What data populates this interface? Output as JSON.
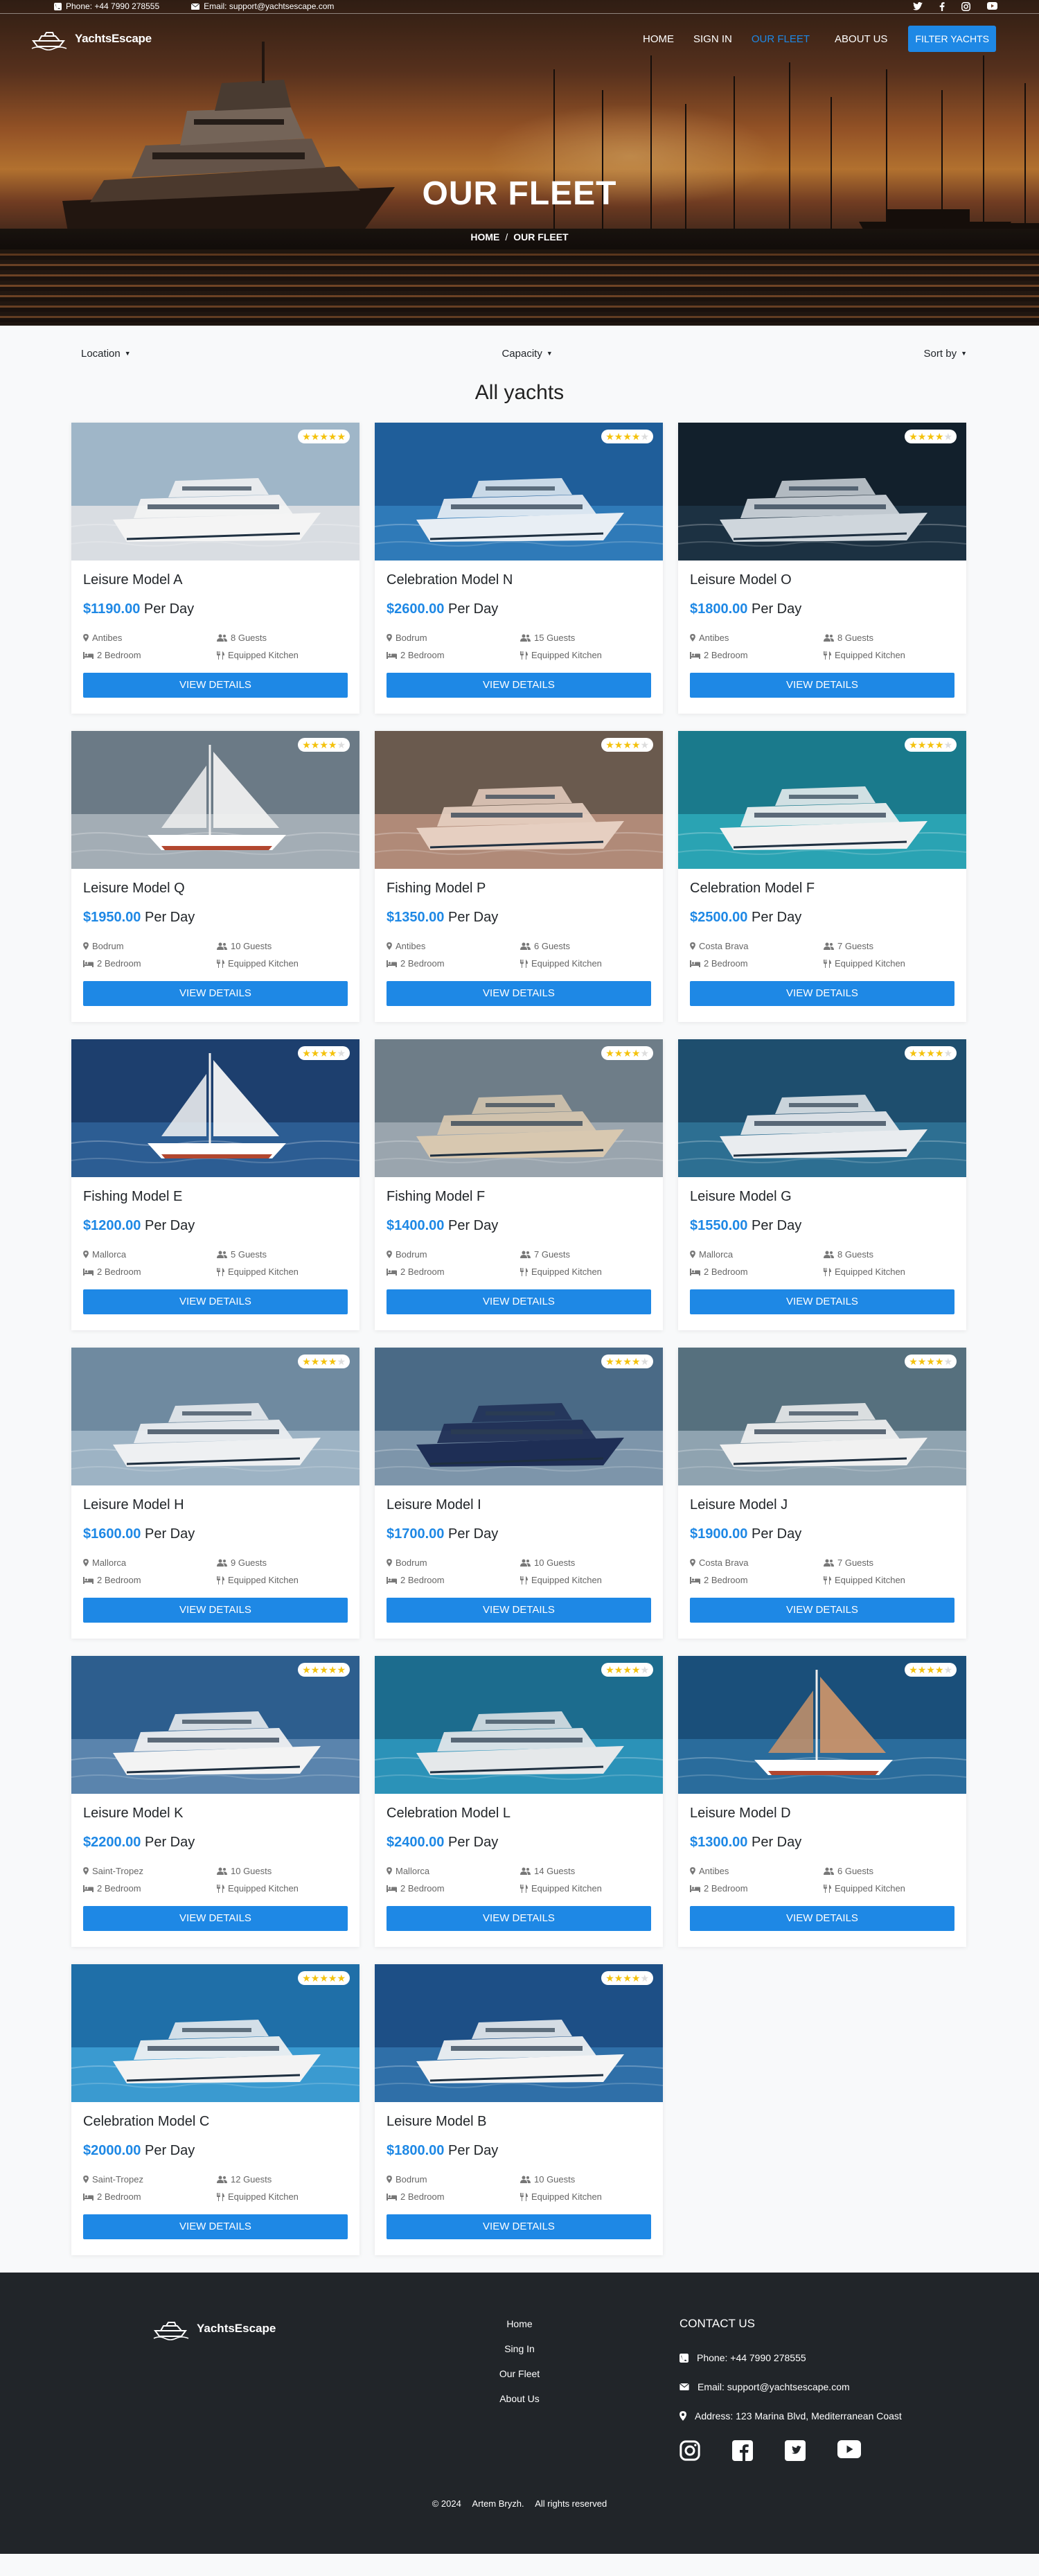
{
  "topbar": {
    "phone": "Phone: +44 7990 278555",
    "email": "Email: support@yachtsescape.com",
    "socials": [
      "twitter-icon",
      "facebook-icon",
      "instagram-icon",
      "youtube-icon"
    ]
  },
  "nav": {
    "brand": "YachtsEscape",
    "links": [
      "HOME",
      "SIGN IN",
      "OUR FLEET",
      "ABOUT US"
    ],
    "active": "OUR FLEET",
    "filter_button": "FILTER YACHTS"
  },
  "hero": {
    "title": "OUR FLEET",
    "breadcrumb_home": "HOME",
    "breadcrumb_sep": "/",
    "breadcrumb_current": "OUR FLEET"
  },
  "filters": {
    "location": "Location",
    "capacity": "Capacity",
    "sort": "Sort by"
  },
  "section_title": "All yachts",
  "card_labels": {
    "per_day": "Per Day",
    "bedroom": "2 Bedroom",
    "kitchen": "Equipped Kitchen",
    "button": "VIEW DETAILS"
  },
  "colors": {
    "accent": "#1e88e5",
    "star": "#f4c20d",
    "footer_bg": "#212529"
  },
  "yachts": [
    {
      "name": "Leisure Model A",
      "price": "$1190.00",
      "location": "Antibes",
      "guests": "8 Guests",
      "rating": 5
    },
    {
      "name": "Celebration Model N",
      "price": "$2600.00",
      "location": "Bodrum",
      "guests": "15 Guests",
      "rating": 4
    },
    {
      "name": "Leisure Model O",
      "price": "$1800.00",
      "location": "Antibes",
      "guests": "8 Guests",
      "rating": 4
    },
    {
      "name": "Leisure Model Q",
      "price": "$1950.00",
      "location": "Bodrum",
      "guests": "10 Guests",
      "rating": 4
    },
    {
      "name": "Fishing Model P",
      "price": "$1350.00",
      "location": "Antibes",
      "guests": "6 Guests",
      "rating": 4
    },
    {
      "name": "Celebration Model F",
      "price": "$2500.00",
      "location": "Costa Brava",
      "guests": "7 Guests",
      "rating": 4
    },
    {
      "name": "Fishing Model E",
      "price": "$1200.00",
      "location": "Mallorca",
      "guests": "5 Guests",
      "rating": 4
    },
    {
      "name": "Fishing Model F",
      "price": "$1400.00",
      "location": "Bodrum",
      "guests": "7 Guests",
      "rating": 4
    },
    {
      "name": "Leisure Model G",
      "price": "$1550.00",
      "location": "Mallorca",
      "guests": "8 Guests",
      "rating": 4
    },
    {
      "name": "Leisure Model H",
      "price": "$1600.00",
      "location": "Mallorca",
      "guests": "9 Guests",
      "rating": 4
    },
    {
      "name": "Leisure Model I",
      "price": "$1700.00",
      "location": "Bodrum",
      "guests": "10 Guests",
      "rating": 4
    },
    {
      "name": "Leisure Model J",
      "price": "$1900.00",
      "location": "Costa Brava",
      "guests": "7 Guests",
      "rating": 4
    },
    {
      "name": "Leisure Model K",
      "price": "$2200.00",
      "location": "Saint-Tropez",
      "guests": "10 Guests",
      "rating": 5
    },
    {
      "name": "Celebration Model L",
      "price": "$2400.00",
      "location": "Mallorca",
      "guests": "14 Guests",
      "rating": 4
    },
    {
      "name": "Leisure Model D",
      "price": "$1300.00",
      "location": "Antibes",
      "guests": "6 Guests",
      "rating": 4
    },
    {
      "name": "Celebration Model C",
      "price": "$2000.00",
      "location": "Saint-Tropez",
      "guests": "12 Guests",
      "rating": 5
    },
    {
      "name": "Leisure Model B",
      "price": "$1800.00",
      "location": "Bodrum",
      "guests": "10 Guests",
      "rating": 4
    }
  ],
  "footer": {
    "brand": "YachtsEscape",
    "links": [
      "Home",
      "Sing In",
      "Our Fleet",
      "About Us"
    ],
    "contact_title": "CONTACT US",
    "phone": "Phone: +44 7990 278555",
    "email": "Email: support@yachtsescape.com",
    "address": "Address: 123 Marina Blvd, Mediterranean Coast",
    "socials": [
      "instagram-icon",
      "facebook-icon",
      "twitter-icon",
      "youtube-icon"
    ],
    "copyright_year": "© 2024",
    "copyright_name": "Artem Bryzh.",
    "copyright_text": "All rights reserved"
  }
}
